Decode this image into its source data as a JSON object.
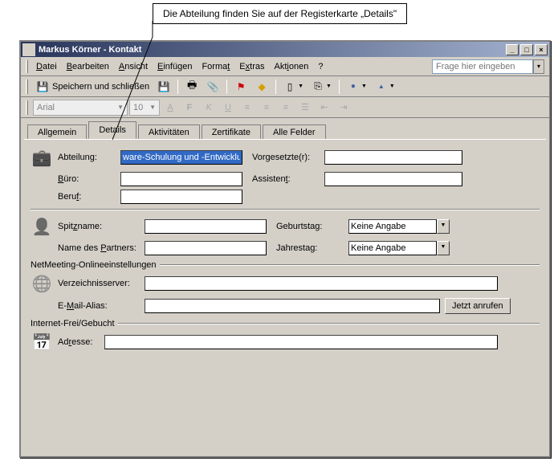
{
  "callout": {
    "text": "Die Abteilung finden Sie auf der Registerkarte „Details\""
  },
  "window": {
    "title": "Markus Körner - Kontakt"
  },
  "menu": {
    "file": "Datei",
    "edit": "Bearbeiten",
    "view": "Ansicht",
    "insert": "Einfügen",
    "format": "Format",
    "extras": "Extras",
    "actions": "Aktionen",
    "help": "?"
  },
  "help_placeholder": "Frage hier eingeben",
  "toolbar": {
    "save_close": "Speichern und schließen"
  },
  "format_bar": {
    "font": "Arial",
    "size": "10"
  },
  "tabs": {
    "general": "Allgemein",
    "details": "Details",
    "activities": "Aktivitäten",
    "certificates": "Zertifikate",
    "allfields": "Alle Felder"
  },
  "form": {
    "department_label": "Abteilung:",
    "department_value": "ware-Schulung und -Entwicklung",
    "office_label": "Büro:",
    "office_value": "",
    "job_label": "Beruf:",
    "job_value": "",
    "manager_label": "Vorgesetzte(r):",
    "manager_value": "",
    "assistant_label": "Assistent:",
    "assistant_value": "",
    "nickname_label": "Spitzname:",
    "nickname_value": "",
    "partner_label": "Name des Partners:",
    "partner_value": "",
    "birthday_label": "Geburtstag:",
    "birthday_value": "Keine Angabe",
    "anniversary_label": "Jahrestag:",
    "anniversary_value": "Keine Angabe",
    "netmeeting_group": "NetMeeting-Onlineeinstellungen",
    "dirserver_label": "Verzeichnisserver:",
    "dirserver_value": "",
    "emailalias_label": "E-Mail-Alias:",
    "emailalias_value": "",
    "callnow_btn": "Jetzt anrufen",
    "freebusy_group": "Internet-Frei/Gebucht",
    "address_label": "Adresse:",
    "address_value": ""
  }
}
